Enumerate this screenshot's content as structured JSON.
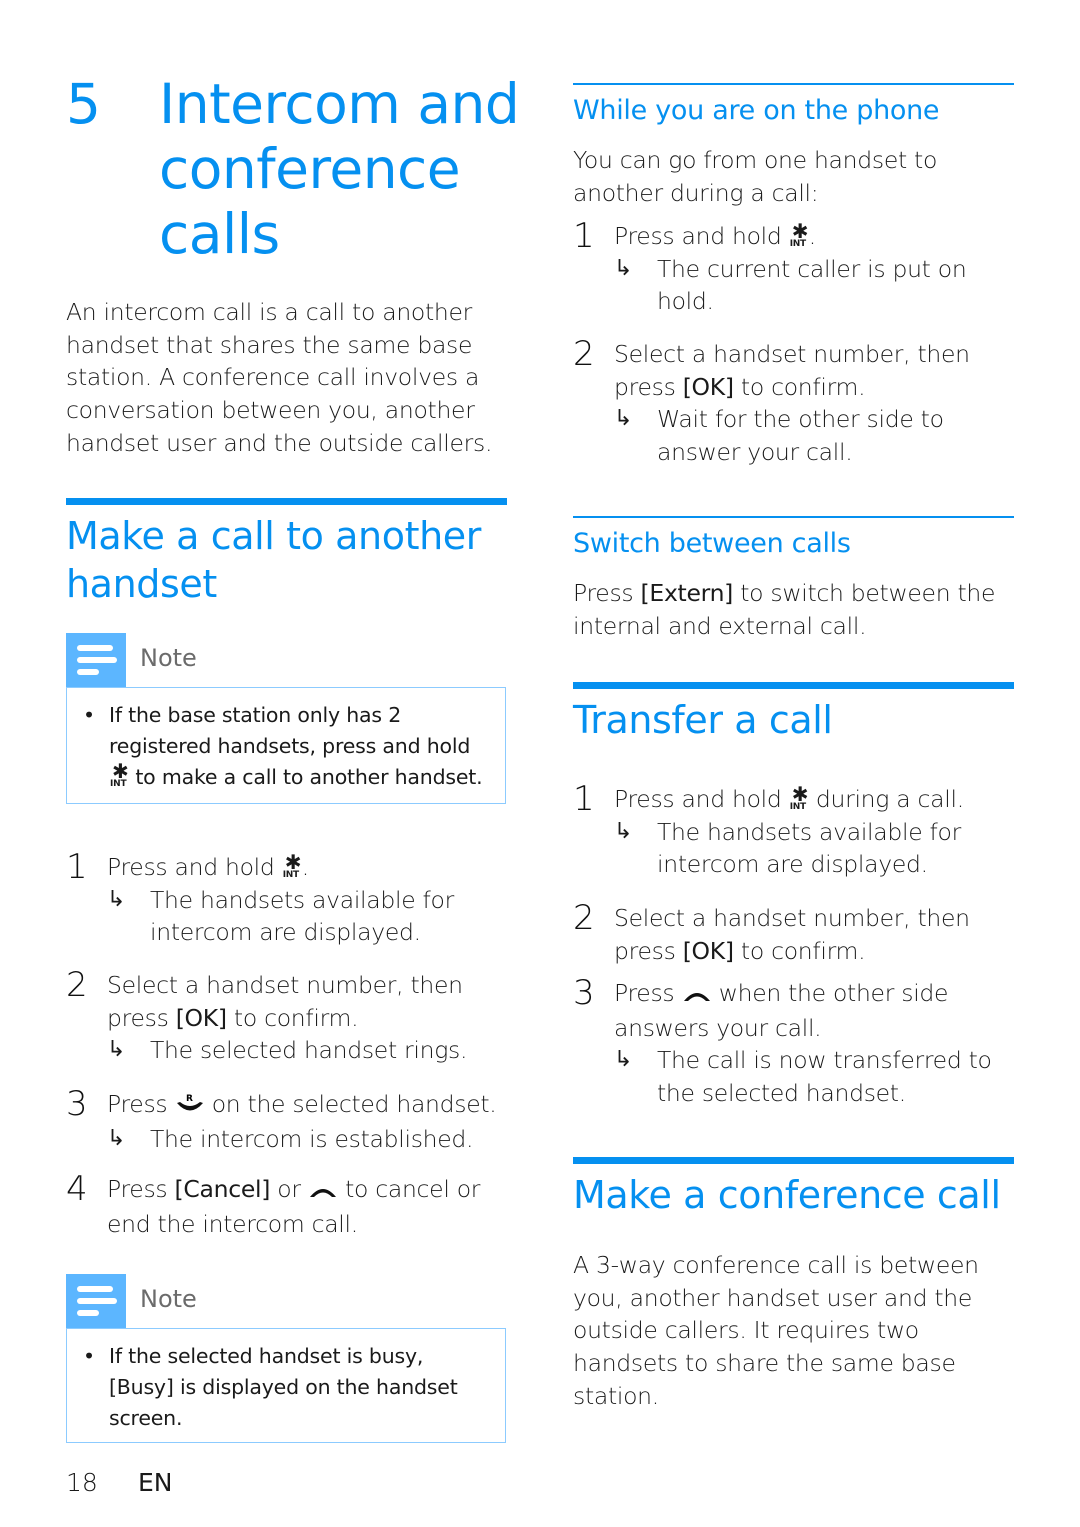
{
  "chapter": {
    "number": "5",
    "title": "Intercom and conference calls"
  },
  "intro": "An intercom call is a call to another handset that shares the same base station. A conference call involves a conversation between you, another handset user and the outside callers.",
  "make_call": {
    "heading": "Make a call to another handset",
    "note1": {
      "label": "Note",
      "bullet": "•",
      "text_before": "If the base station only has 2 registered handsets, press and hold",
      "text_after": "to make a call to another handset."
    },
    "steps": [
      {
        "number": "1",
        "text_before": "Press and hold",
        "text_after": ".",
        "result": "The handsets available for intercom are displayed."
      },
      {
        "number": "2",
        "text_before": "Select a handset number, then press",
        "keyword": "[OK]",
        "text_after": "to confirm.",
        "result": "The selected handset rings."
      },
      {
        "number": "3",
        "text_before": "Press",
        "text_after": "on the selected handset.",
        "result": "The intercom is established."
      },
      {
        "number": "4",
        "text_before": "Press",
        "keyword": "[Cancel]",
        "text_mid": "or",
        "text_after": "to cancel or end the intercom call."
      }
    ],
    "note2": {
      "label": "Note",
      "bullet": "•",
      "text_before": "If the selected handset is busy,",
      "keyword": "[Busy]",
      "text_after": "is displayed on the handset screen."
    }
  },
  "while_on_phone": {
    "heading": "While you are on the phone",
    "intro": "You can go from one handset to another during a call:",
    "steps": [
      {
        "number": "1",
        "text_before": "Press and hold",
        "text_after": ".",
        "result": "The current caller is put on hold."
      },
      {
        "number": "2",
        "text_before": "Select a handset number, then press",
        "keyword": "[OK]",
        "text_after": "to confirm.",
        "result": "Wait for the other side to answer your call."
      }
    ]
  },
  "switch_calls": {
    "heading": "Switch between calls",
    "text_before": "Press",
    "keyword": "[Extern]",
    "text_after": "to switch between the internal and external call."
  },
  "transfer": {
    "heading": "Transfer a call",
    "steps": [
      {
        "number": "1",
        "text_before": "Press and hold",
        "text_after": "during a call.",
        "result": "The handsets available for intercom are displayed."
      },
      {
        "number": "2",
        "text_before": "Select a handset number, then press",
        "keyword": "[OK]",
        "text_after": "to confirm."
      },
      {
        "number": "3",
        "text_before": "Press",
        "text_after": "when the other side answers your call.",
        "result": "The call is now transferred to the selected handset."
      }
    ]
  },
  "conference": {
    "heading": "Make a conference call",
    "text": "A 3-way conference call is between you, another handset user and the outside callers. It requires two handsets to share the same base station."
  },
  "icons": {
    "int_star": "✱",
    "int_label": "INT",
    "result_arrow": "↳",
    "talk_key_label": "R"
  },
  "footer": {
    "page_number": "18",
    "language": "EN"
  },
  "colors": {
    "accent": "#0590f0",
    "note_icon": "#5cb6ff",
    "note_border": "#8ccbff"
  }
}
